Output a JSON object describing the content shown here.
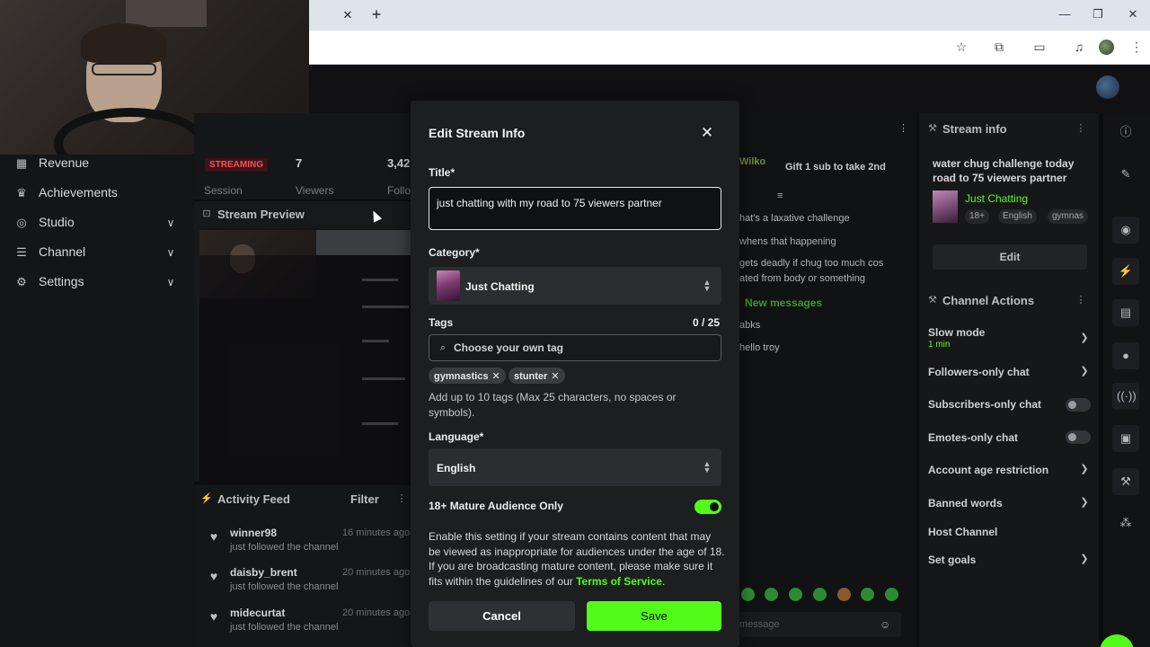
{
  "browser": {
    "tab_close": "✕",
    "new_tab": "+",
    "window_controls": [
      "minimize",
      "restore",
      "close"
    ],
    "toolbar_icons": [
      "star-icon",
      "extensions-icon",
      "tab-search-icon",
      "media-icon",
      "profile-avatar",
      "menu-icon"
    ]
  },
  "sidebar": {
    "items": [
      {
        "label": "Revenue",
        "icon": "revenue-icon",
        "has_chevron": false
      },
      {
        "label": "Achievements",
        "icon": "trophy-icon",
        "has_chevron": false
      },
      {
        "label": "Studio",
        "icon": "studio-icon",
        "has_chevron": true
      },
      {
        "label": "Channel",
        "icon": "channel-icon",
        "has_chevron": true
      },
      {
        "label": "Settings",
        "icon": "gear-icon",
        "has_chevron": true
      }
    ]
  },
  "stats": {
    "status_badge": "STREAMING",
    "session_label": "Session",
    "viewers_value": "7",
    "viewers_label": "Viewers",
    "followers_value": "3,42",
    "followers_label": "Follo"
  },
  "stream_preview": {
    "title": "Stream Preview"
  },
  "activity_feed": {
    "title": "Activity Feed",
    "filter_label": "Filter",
    "items": [
      {
        "name": "winner98",
        "time": "16 minutes ago",
        "action": "just followed the channel"
      },
      {
        "name": "daisby_brent",
        "time": "20 minutes ago",
        "action": "just followed the channel"
      },
      {
        "name": "midecurtat",
        "time": "20 minutes ago",
        "action": "just followed the channel"
      }
    ]
  },
  "chat": {
    "header_user": "Wilko",
    "gift_banner": "Gift 1 sub to take 2nd",
    "messages": [
      "hat's a laxative challenge",
      "whens that happening",
      "gets deadly if chug too much cos",
      "ated from body or something",
      "abks",
      "hello troy"
    ],
    "new_messages_label": "New messages",
    "input_placeholder": "message"
  },
  "right_panel": {
    "stream_info_title": "Stream info",
    "stream_title": "water chug challenge today road to 75 viewers partner",
    "category": "Just Chatting",
    "tags": [
      "18+",
      "English",
      "gymnas"
    ],
    "edit_label": "Edit",
    "channel_actions_title": "Channel Actions",
    "actions": [
      {
        "label": "Slow mode",
        "sub": "1 min",
        "control": "chevron"
      },
      {
        "label": "Followers-only chat",
        "sub": "",
        "control": "chevron"
      },
      {
        "label": "Subscribers-only chat",
        "sub": "",
        "control": "toggle"
      },
      {
        "label": "Emotes-only chat",
        "sub": "",
        "control": "toggle"
      },
      {
        "label": "Account age restriction",
        "sub": "",
        "control": "chevron"
      },
      {
        "label": "Banned words",
        "sub": "",
        "control": "chevron"
      },
      {
        "label": "Host Channel",
        "sub": "",
        "control": "none"
      },
      {
        "label": "Set goals",
        "sub": "",
        "control": "chevron"
      }
    ]
  },
  "modal": {
    "title": "Edit Stream Info",
    "title_label": "Title*",
    "title_value": "just chatting with my road to 75 viewers partner",
    "category_label": "Category*",
    "category_value": "Just Chatting",
    "tags_label": "Tags",
    "tags_count": "0 / 25",
    "tags_placeholder": "Choose your own tag",
    "tags": [
      "gymnastics",
      "stunter"
    ],
    "tags_help_line1": "Add up to 10 tags (Max 25 characters, no spaces or",
    "tags_help_line2": "symbols).",
    "language_label": "Language*",
    "language_value": "English",
    "mature_label": "18+ Mature Audience Only",
    "mature_enabled": true,
    "mature_desc": "Enable this setting if your stream contains content that may be viewed as inappropriate for audiences under the age of 18. If you are broadcasting mature content, please make sure it fits within the guidelines of our",
    "tos_link": "Terms of Service",
    "cancel_label": "Cancel",
    "save_label": "Save"
  },
  "colors": {
    "accent": "#53fc18",
    "streaming_badge": "#ff4d5a",
    "background": "#0d0d0f",
    "modal_bg": "#1d1e20"
  }
}
